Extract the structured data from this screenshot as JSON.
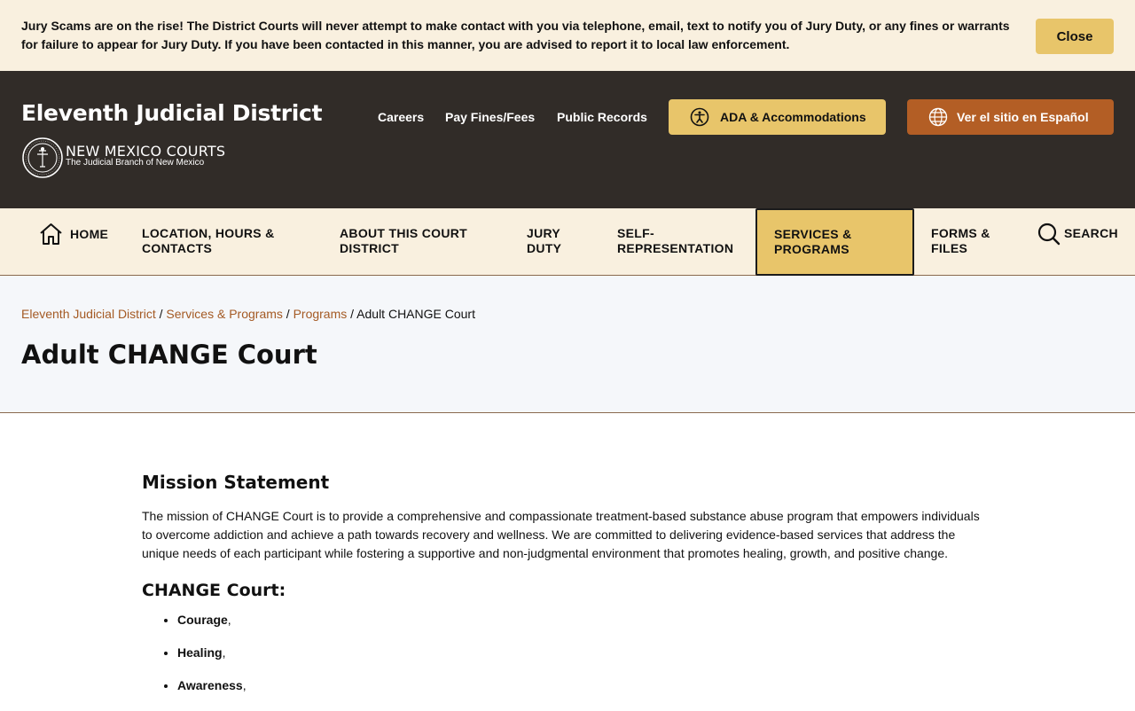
{
  "alert": {
    "text": "Jury Scams are on the rise! The District Courts will never attempt to make contact with you via telephone, email, text to notify you of Jury Duty, or any fines or warrants for failure to appear for Jury Duty. If you have been contacted in this manner, you are advised to report it to local law enforcement.",
    "close_label": "Close"
  },
  "header": {
    "site_title": "Eleventh Judicial District",
    "logo_title": "NEW MEXICO COURTS",
    "logo_subtitle": "The Judicial Branch of New Mexico",
    "links": [
      "Careers",
      "Pay Fines/Fees",
      "Public Records"
    ],
    "ada_label": "ADA & Accommodations",
    "spanish_label": "Ver el sitio en Español"
  },
  "nav": {
    "home": "HOME",
    "location": "LOCATION, HOURS & CONTACTS",
    "about": "ABOUT THIS COURT DISTRICT",
    "jury": "JURY DUTY",
    "self_rep": "SELF-REPRESENTATION",
    "services": "SERVICES & PROGRAMS",
    "forms": "FORMS & FILES",
    "search": "SEARCH"
  },
  "breadcrumb": {
    "items": [
      "Eleventh Judicial District",
      "Services & Programs",
      "Programs"
    ],
    "current": "Adult CHANGE Court"
  },
  "page_title": "Adult CHANGE Court",
  "content": {
    "mission_heading": "Mission Statement",
    "mission_text": "The mission of CHANGE Court is to provide a comprehensive and compassionate treatment-based substance abuse program that empowers individuals to overcome addiction and achieve a path towards recovery and wellness. We are committed to delivering evidence-based services that address the unique needs of each participant while fostering a supportive and non-judgmental environment that promotes healing, growth, and positive change.",
    "change_heading": "CHANGE Court:",
    "list": [
      "Courage",
      "Healing",
      "Awareness"
    ]
  },
  "colors": {
    "header_bg": "#312c28",
    "accent_gold": "#e8c56a",
    "accent_orange": "#b35e25",
    "link": "#a45a24"
  }
}
